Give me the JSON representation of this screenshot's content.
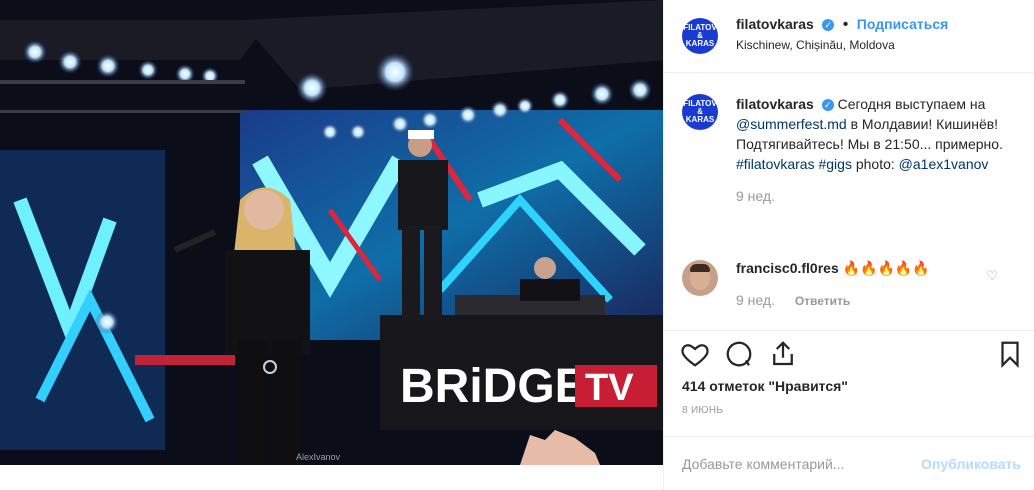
{
  "header": {
    "avatar_text": "FILATOV & KARAS",
    "username": "filatovkaras",
    "separator": "•",
    "follow_label": "Подписаться",
    "location": "Kischinew, Chișinău, Moldova"
  },
  "caption": {
    "username": "filatovkaras",
    "text_1": "Сегодня выступаем на",
    "mention": "@summerfest.md",
    "text_2": "в Молдавии! Кишинёв! Подтягивайтесь! Мы в 21:50... примерно.",
    "tags": "#filatovkaras #gigs",
    "text_3": "photo:",
    "photo_mention": "@a1ex1vanov",
    "time": "9 нед."
  },
  "comment": {
    "username": "francisc0.fl0res",
    "text": "🔥🔥🔥🔥🔥",
    "time": "9 нед.",
    "reply_label": "Ответить"
  },
  "likes": "414 отметок \"Нравится\"",
  "date": "8 ИЮНЬ",
  "add_comment": {
    "placeholder": "Добавьте комментарий...",
    "publish_label": "Опубликовать"
  },
  "photo": {
    "brand_main": "BRiDGE",
    "brand_tv": "TV",
    "watermark": "AlexIvanov"
  }
}
